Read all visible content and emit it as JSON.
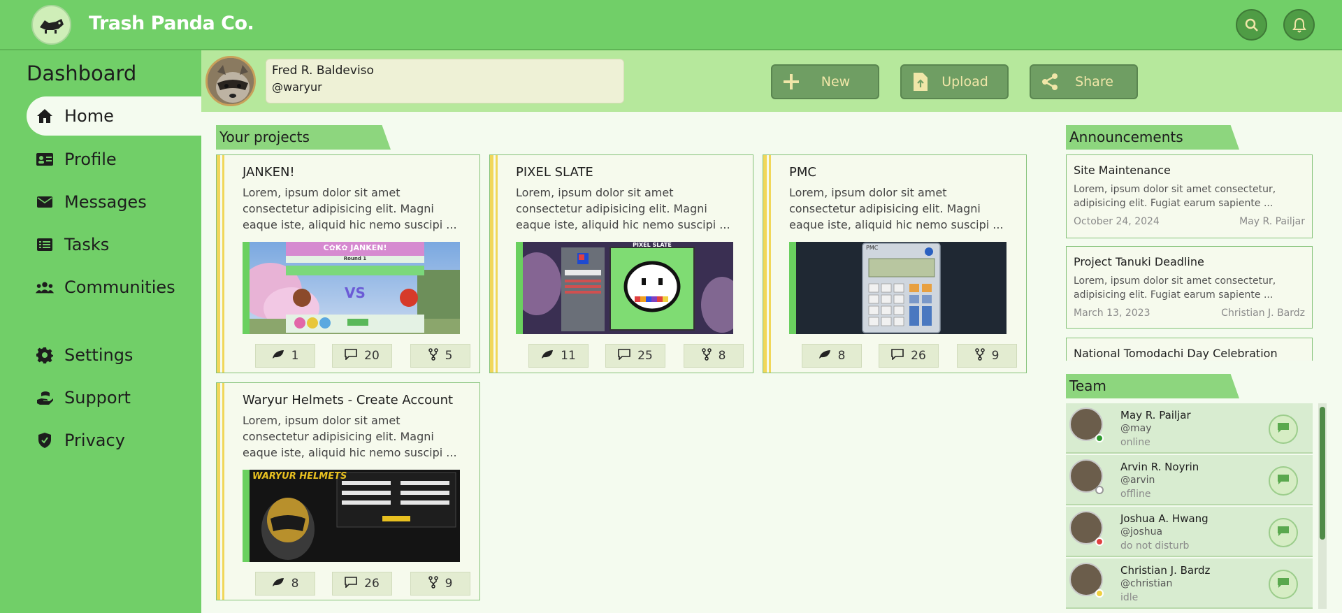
{
  "brand": {
    "name": "Trash Panda Co."
  },
  "topbar": {
    "search_icon": "search-icon",
    "bell_icon": "bell-icon"
  },
  "sidebar": {
    "title": "Dashboard",
    "items": [
      {
        "label": "Home",
        "icon": "home-icon",
        "active": true
      },
      {
        "label": "Profile",
        "icon": "id-card-icon"
      },
      {
        "label": "Messages",
        "icon": "envelope-icon"
      },
      {
        "label": "Tasks",
        "icon": "list-icon"
      },
      {
        "label": "Communities",
        "icon": "people-icon"
      },
      {
        "label": "Settings",
        "icon": "gear-icon"
      },
      {
        "label": "Support",
        "icon": "hand-holding-icon"
      },
      {
        "label": "Privacy",
        "icon": "shield-icon"
      }
    ]
  },
  "user": {
    "name": "Fred R. Baldeviso",
    "handle": "@waryur"
  },
  "actions": {
    "new_label": "New",
    "upload_label": "Upload",
    "share_label": "Share"
  },
  "projects": {
    "title": "Your projects",
    "items": [
      {
        "title": "JANKEN!",
        "desc": "Lorem, ipsum dolor sit amet consectetur adipisicing elit. Magni eaque iste, aliquid hic nemo suscipi ...",
        "likes": "1",
        "comments": "20",
        "forks": "5",
        "banner_text": "C✿K✿ JANKEN!",
        "round_text": "Round 1",
        "vs_text": "VS"
      },
      {
        "title": "PIXEL SLATE",
        "desc": "Lorem, ipsum dolor sit amet consectetur adipisicing elit. Magni eaque iste, aliquid hic nemo suscipi ...",
        "likes": "11",
        "comments": "25",
        "forks": "8",
        "banner_text": "PIXEL SLATE"
      },
      {
        "title": "PMC",
        "desc": "Lorem, ipsum dolor sit amet consectetur adipisicing elit. Magni eaque iste, aliquid hic nemo suscipi ...",
        "likes": "8",
        "comments": "26",
        "forks": "9",
        "banner_text": "PMC"
      },
      {
        "title": "Waryur Helmets - Create Account",
        "desc": "Lorem, ipsum dolor sit amet consectetur adipisicing elit. Magni eaque iste, aliquid hic nemo suscipi ...",
        "likes": "8",
        "comments": "26",
        "forks": "9",
        "banner_text": "WARYUR HELMETS"
      }
    ]
  },
  "announcements": {
    "title": "Announcements",
    "items": [
      {
        "title": "Site Maintenance",
        "body": "Lorem, ipsum dolor sit amet consectetur, adipisicing elit. Fugiat earum sapiente ...",
        "date": "October 24, 2024",
        "author": "May R. Pailjar"
      },
      {
        "title": "Project Tanuki Deadline",
        "body": "Lorem, ipsum dolor sit amet consectetur, adipisicing elit. Fugiat earum sapiente ...",
        "date": "March 13, 2023",
        "author": "Christian J. Bardz"
      },
      {
        "title": "National Tomodachi Day Celebration"
      }
    ]
  },
  "team": {
    "title": "Team",
    "members": [
      {
        "name": "May R. Pailjar",
        "handle": "@may",
        "status": "online",
        "status_color": "#2e9b2e"
      },
      {
        "name": "Arvin R. Noyrin",
        "handle": "@arvin",
        "status": "offline",
        "status_color": "#ffffff"
      },
      {
        "name": "Joshua A. Hwang",
        "handle": "@joshua",
        "status": "do not disturb",
        "status_color": "#e04040"
      },
      {
        "name": "Christian J. Bardz",
        "handle": "@christian",
        "status": "idle",
        "status_color": "#f0d040"
      }
    ]
  },
  "colors": {
    "primary": "#71cf68",
    "accent": "#f1d75a",
    "button": "#6f9e63",
    "background": "#f4fbef"
  }
}
